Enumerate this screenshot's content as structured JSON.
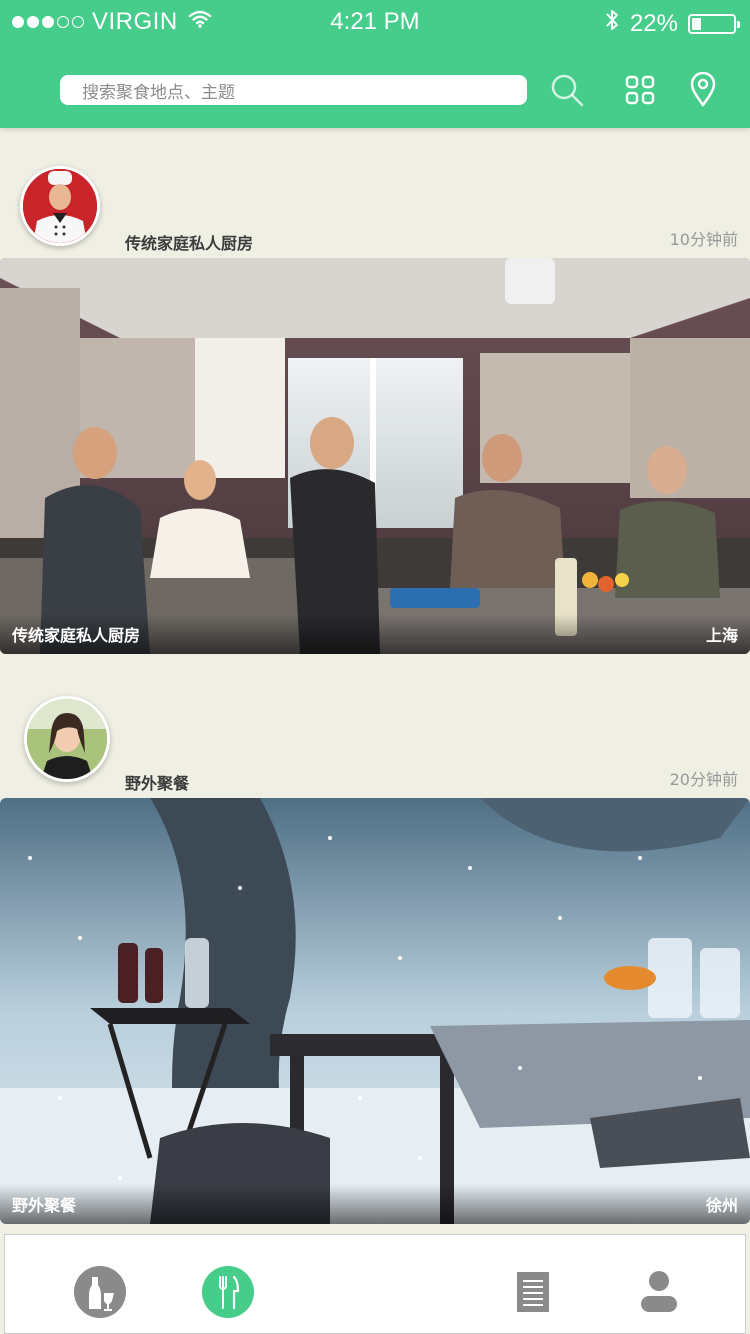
{
  "status": {
    "carrier": "VIRGIN",
    "time": "4:21 PM",
    "battery": "22%",
    "battery_level": 0.22,
    "signal_dots": [
      true,
      true,
      true,
      false,
      false
    ]
  },
  "search": {
    "placeholder": "搜索聚食地点、主题"
  },
  "header_icons": [
    "search-icon",
    "grid-icon",
    "location-pin-icon"
  ],
  "posts": [
    {
      "title": "传统家庭私人厨房",
      "time_ago": "10分钟前",
      "caption_title": "传统家庭私人厨房",
      "caption_city": "上海"
    },
    {
      "title": "野外聚餐",
      "time_ago": "20分钟前",
      "caption_title": "野外聚餐",
      "caption_city": "徐州"
    }
  ],
  "tabs": [
    "drink-icon",
    "dining-icon",
    "menu-list-icon",
    "profile-icon"
  ],
  "colors": {
    "accent": "#46cd8c",
    "background": "#efefe4",
    "tab_inactive": "#8a8a8a"
  }
}
